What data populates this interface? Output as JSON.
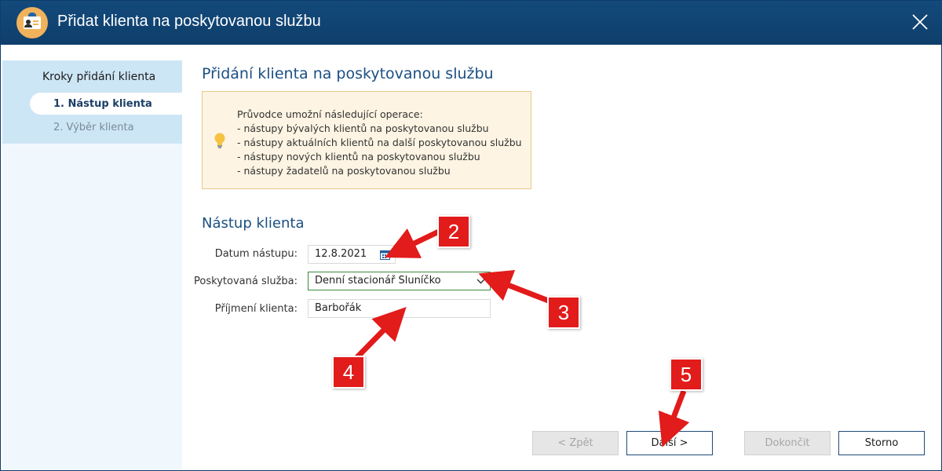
{
  "window": {
    "title": "Přidat klienta na poskytovanou službu"
  },
  "sidebar": {
    "title": "Kroky přidání klienta",
    "steps": [
      {
        "label": "1. Nástup klienta",
        "active": true
      },
      {
        "label": "2. Výběr klienta",
        "active": false
      }
    ]
  },
  "main": {
    "heading": "Přidání klienta na poskytovanou službu",
    "info": {
      "lines": [
        "Průvodce umožní následující operace:",
        "- nástupy bývalých klientů na poskytovanou službu",
        "- nástupy aktuálních klientů na další poskytovanou službu",
        "- nástupy nových klientů na poskytovanou službu",
        "- nástupy žadatelů na poskytovanou službu"
      ]
    },
    "section_heading": "Nástup klienta",
    "form": {
      "date_label": "Datum nástupu:",
      "date_value": "12.8.2021",
      "service_label": "Poskytovaná služba:",
      "service_value": "Denní stacionář Sluníčko",
      "surname_label": "Příjmení klienta:",
      "surname_value": "Barbořák"
    }
  },
  "buttons": {
    "back": "< Zpět",
    "next": "Další >",
    "finish": "Dokončit",
    "cancel": "Storno"
  },
  "callouts": [
    "2",
    "3",
    "4",
    "5"
  ],
  "colors": {
    "titlebar": "#134a7b",
    "accent": "#1b4f82",
    "callout": "#e21b1b",
    "info_bg": "#fdf4e3"
  }
}
